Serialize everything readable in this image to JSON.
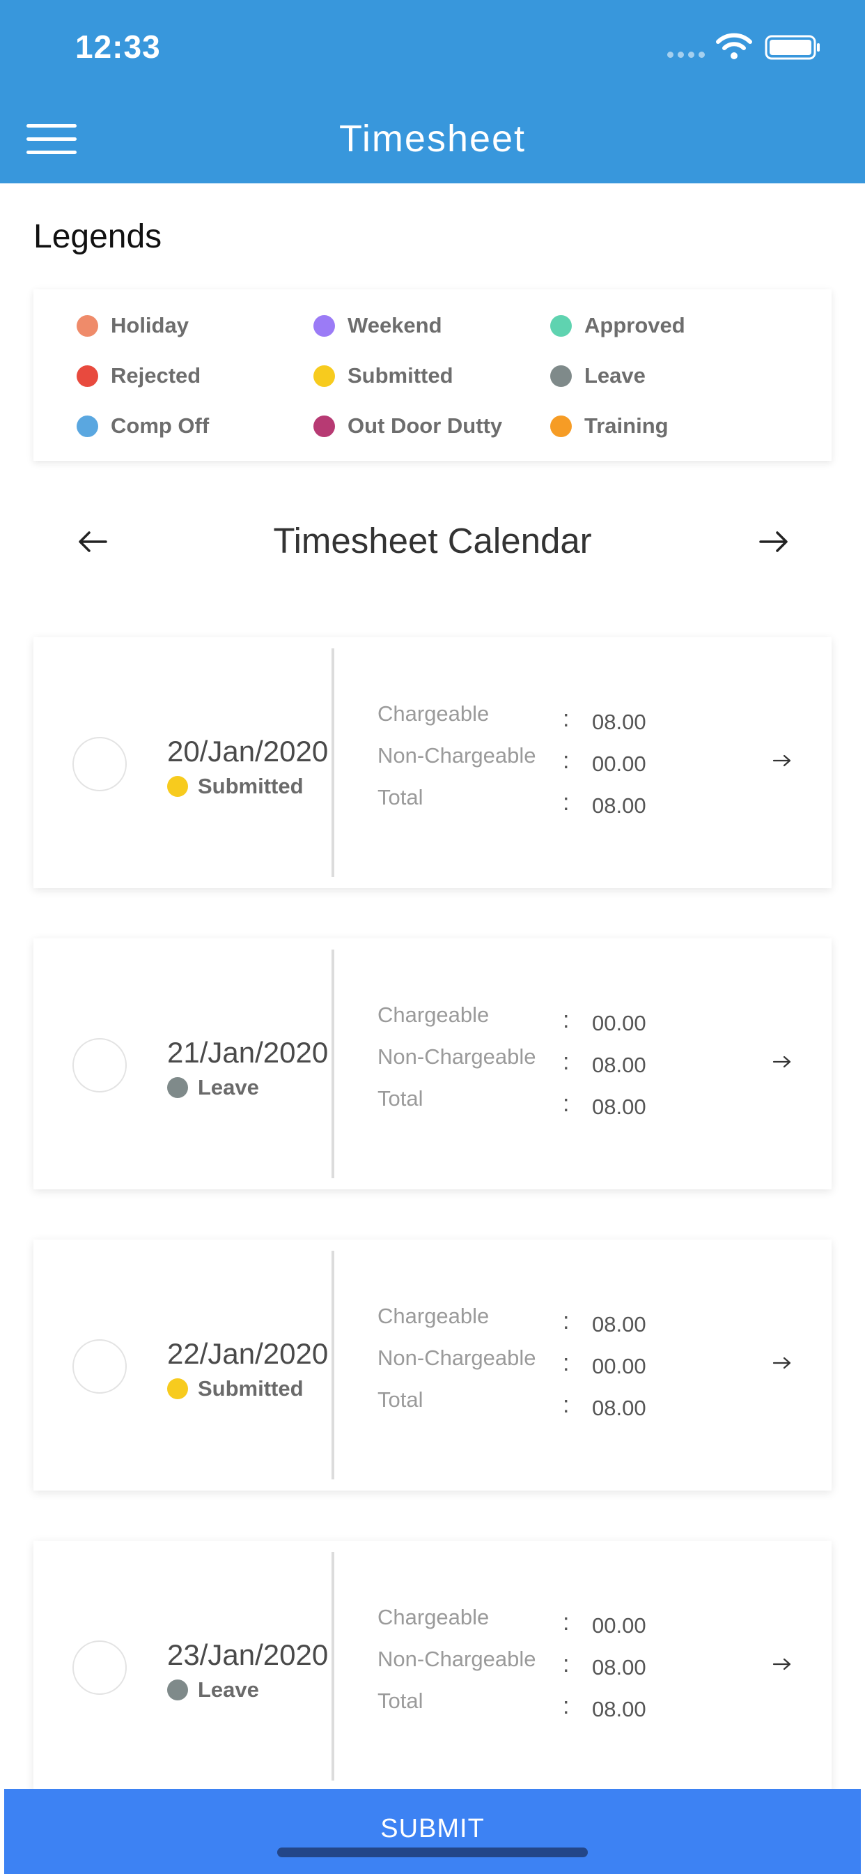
{
  "status_bar": {
    "time": "12:33"
  },
  "header": {
    "title": "Timesheet"
  },
  "legends": {
    "title": "Legends",
    "items": [
      {
        "label": "Holiday",
        "color": "#ef8b6a"
      },
      {
        "label": "Weekend",
        "color": "#9b7bf6"
      },
      {
        "label": "Approved",
        "color": "#5fd3b0"
      },
      {
        "label": "Rejected",
        "color": "#e84a3e"
      },
      {
        "label": "Submitted",
        "color": "#f7cb1e"
      },
      {
        "label": "Leave",
        "color": "#7f8a8a"
      },
      {
        "label": "Comp Off",
        "color": "#5aa7e0"
      },
      {
        "label": "Out Door Dutty",
        "color": "#b73a73"
      },
      {
        "label": "Training",
        "color": "#f69c25"
      }
    ]
  },
  "calendar": {
    "title": "Timesheet Calendar",
    "labels": {
      "chargeable": "Chargeable",
      "non_chargeable": "Non-Chargeable",
      "total": "Total",
      "colon": ":"
    },
    "days": [
      {
        "date": "20/Jan/2020",
        "status": "Submitted",
        "status_color": "#f7cb1e",
        "chargeable": "08.00",
        "non_chargeable": "00.00",
        "total": "08.00"
      },
      {
        "date": "21/Jan/2020",
        "status": "Leave",
        "status_color": "#7f8a8a",
        "chargeable": "00.00",
        "non_chargeable": "08.00",
        "total": "08.00"
      },
      {
        "date": "22/Jan/2020",
        "status": "Submitted",
        "status_color": "#f7cb1e",
        "chargeable": "08.00",
        "non_chargeable": "00.00",
        "total": "08.00"
      },
      {
        "date": "23/Jan/2020",
        "status": "Leave",
        "status_color": "#7f8a8a",
        "chargeable": "00.00",
        "non_chargeable": "08.00",
        "total": "08.00"
      }
    ]
  },
  "submit": {
    "label": "SUBMIT"
  },
  "colors": {
    "header": "#3897dc",
    "submit": "#3d82f3"
  }
}
